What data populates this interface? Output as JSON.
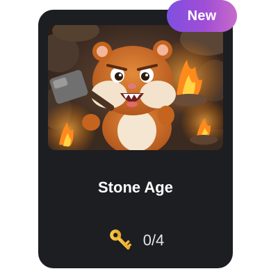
{
  "card": {
    "badge_label": "New",
    "title": "Stone Age",
    "progress_text": "0/4",
    "image_icon": "hamster-caveman-illustration",
    "progress_icon": "key-icon"
  },
  "colors": {
    "card_bg": "#1c1e22",
    "badge_start": "#7f4fe0",
    "badge_end": "#c86bc9",
    "key_gold": "#f2b81c"
  }
}
